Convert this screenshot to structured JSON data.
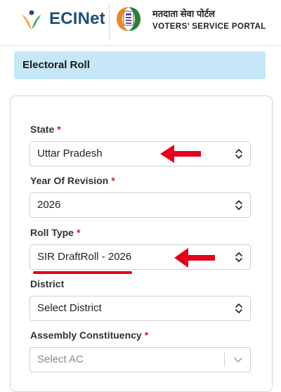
{
  "header": {
    "brand": "ECINet",
    "portal_name_hi": "मतदाता सेवा पोर्टल",
    "portal_name_en": "VOTERS’ SERVICE PORTAL"
  },
  "banner": {
    "title": "Electoral Roll"
  },
  "form": {
    "required_marker": "*",
    "state": {
      "label": "State",
      "value": "Uttar Pradesh"
    },
    "year": {
      "label": "Year Of Revision",
      "value": "2026"
    },
    "roll_type": {
      "label": "Roll Type",
      "value": "SIR DraftRoll - 2026"
    },
    "district": {
      "label": "District",
      "placeholder": "Select District"
    },
    "ac": {
      "label": "Assembly Constituency",
      "placeholder": "Select AC"
    }
  },
  "colors": {
    "brand": "#1f4e79",
    "banner_bg": "#c6e7f7",
    "annotation_red": "#e4001b",
    "required": "#d42020"
  }
}
